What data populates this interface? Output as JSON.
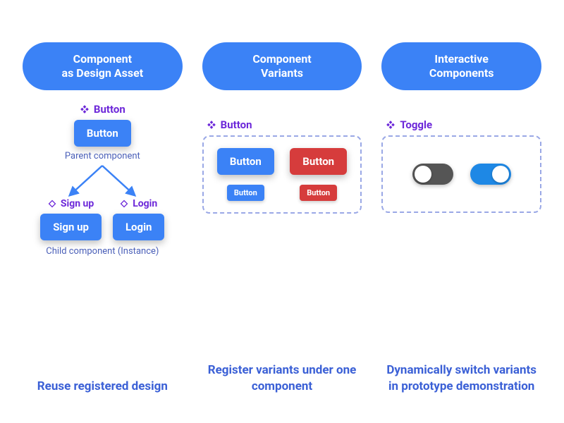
{
  "columns": [
    {
      "header": "Component\nas Design Asset",
      "component_label": "Button",
      "parent_button": "Button",
      "parent_note": "Parent component",
      "children": [
        {
          "label": "Sign up",
          "button": "Sign up"
        },
        {
          "label": "Login",
          "button": "Login"
        }
      ],
      "children_note": "Child component (Instance)",
      "caption": "Reuse registered design"
    },
    {
      "header": "Component\nVariants",
      "component_label": "Button",
      "variants": {
        "blue_large": "Button",
        "red_large": "Button",
        "blue_small": "Button",
        "red_small": "Button"
      },
      "caption": "Register variants under one component"
    },
    {
      "header": "Interactive\nComponents",
      "component_label": "Toggle",
      "caption": "Dynamically switch variants in prototype demonstration"
    }
  ],
  "colors": {
    "primary": "#3b82f6",
    "danger": "#d63c3c",
    "purple": "#6d28d9",
    "caption": "#3b60d6"
  }
}
